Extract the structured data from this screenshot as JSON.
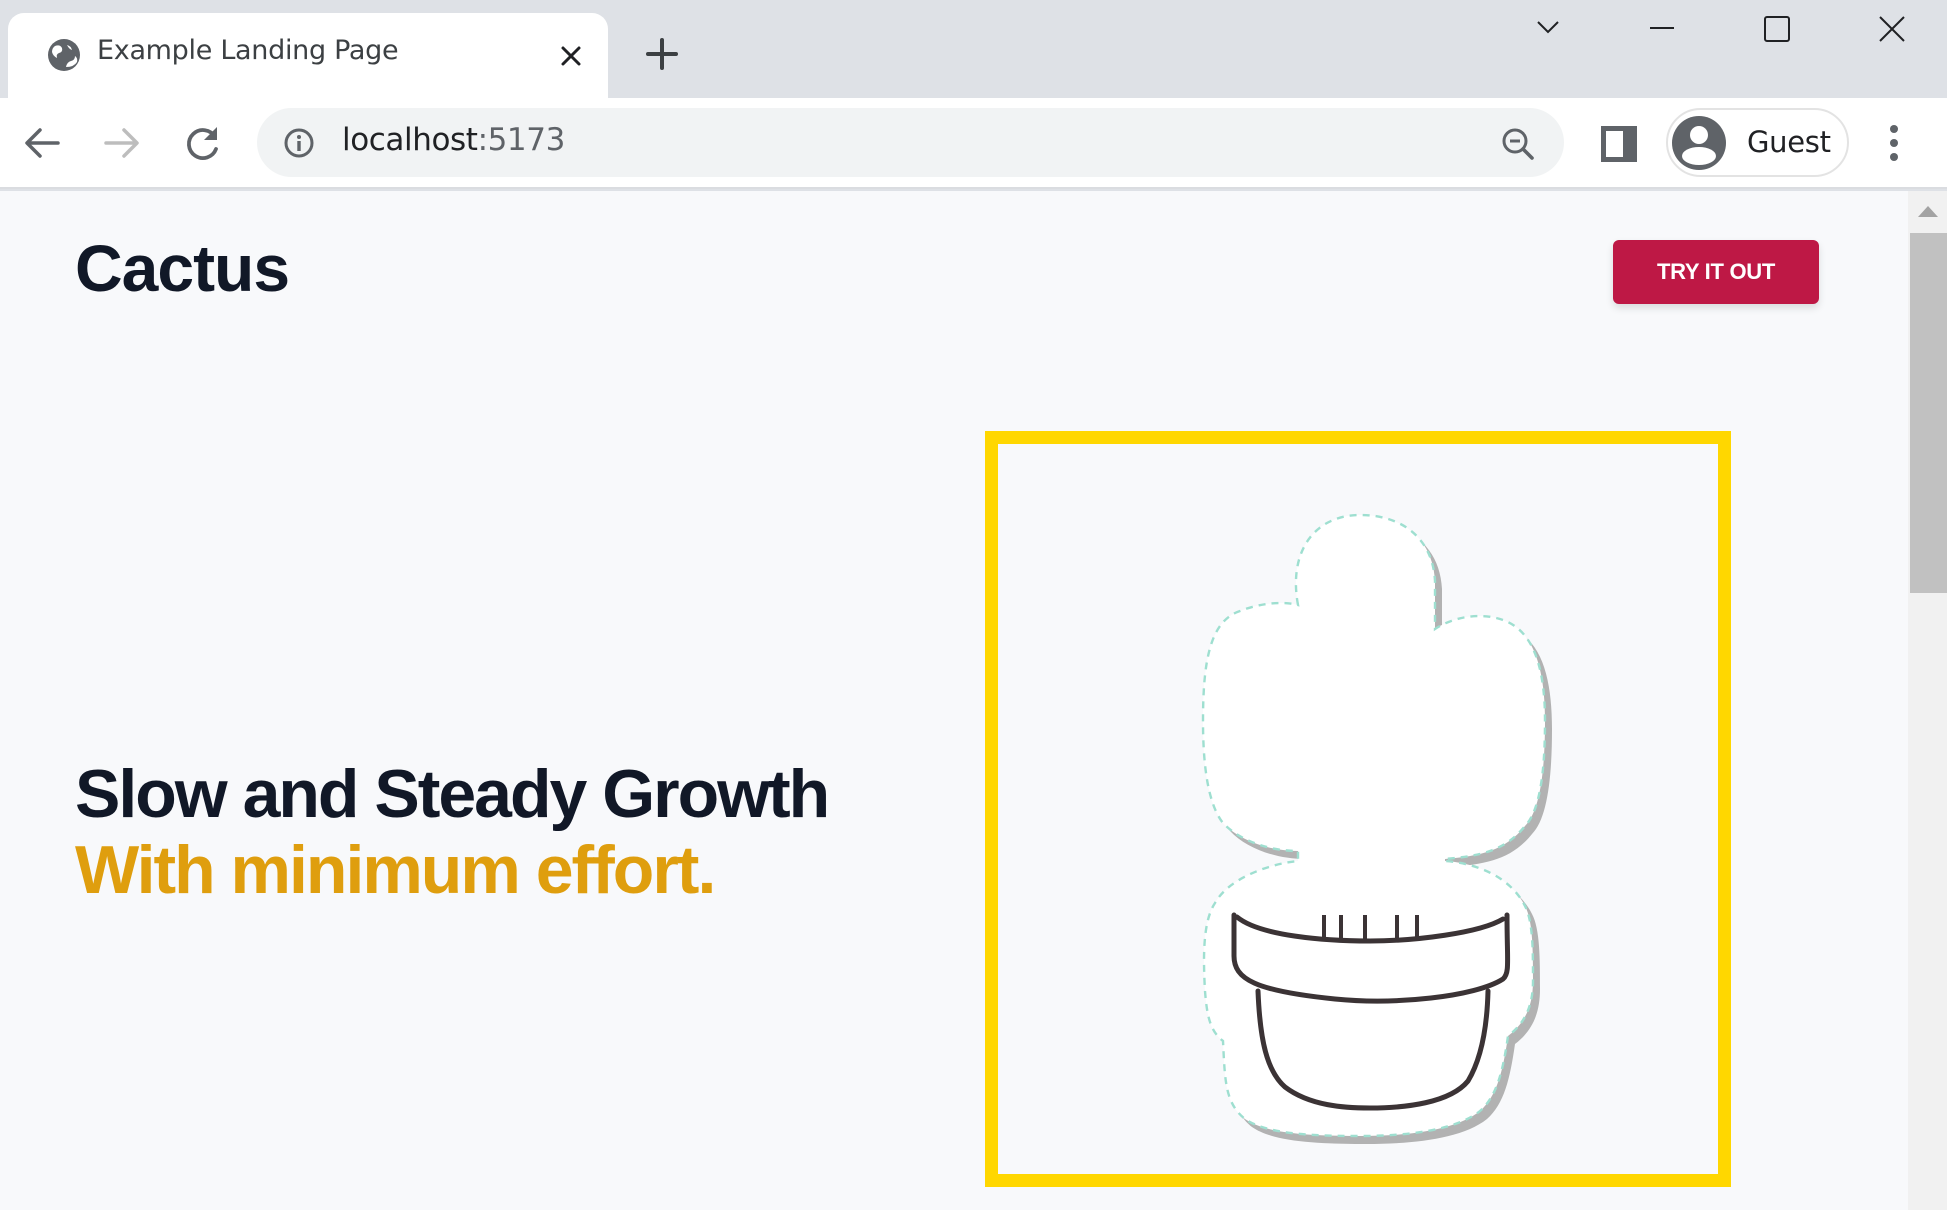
{
  "browser": {
    "tab": {
      "title": "Example Landing Page",
      "favicon": "globe-icon"
    },
    "new_tab_icon": "plus-icon",
    "window_controls": [
      "chevron-down-icon",
      "minimize-icon",
      "maximize-icon",
      "close-icon"
    ],
    "toolbar": {
      "back_icon": "arrow-left-icon",
      "forward_icon": "arrow-right-icon",
      "forward_enabled": false,
      "reload_icon": "reload-icon",
      "site_info_icon": "info-icon",
      "url_host": "localhost",
      "url_port": ":5173",
      "zoom_icon": "zoom-out-icon",
      "side_panel_icon": "side-panel-icon",
      "profile_label": "Guest",
      "menu_icon": "kebab-menu-icon"
    }
  },
  "page": {
    "logo": "Cactus",
    "cta_label": "TRY IT OUT",
    "headline_line1": "Slow and Steady Growth",
    "headline_line2": "With minimum effort.",
    "hero_image": "cactus-in-pot-illustration"
  },
  "colors": {
    "page_background": "#f8f9fb",
    "text_dark": "#111827",
    "accent_yellow_text": "#df9e0e",
    "cta_background": "#be1845",
    "frame_border": "#ffd700",
    "sticker_dash": "#9edfd0",
    "pot_stroke": "#3b3335"
  }
}
